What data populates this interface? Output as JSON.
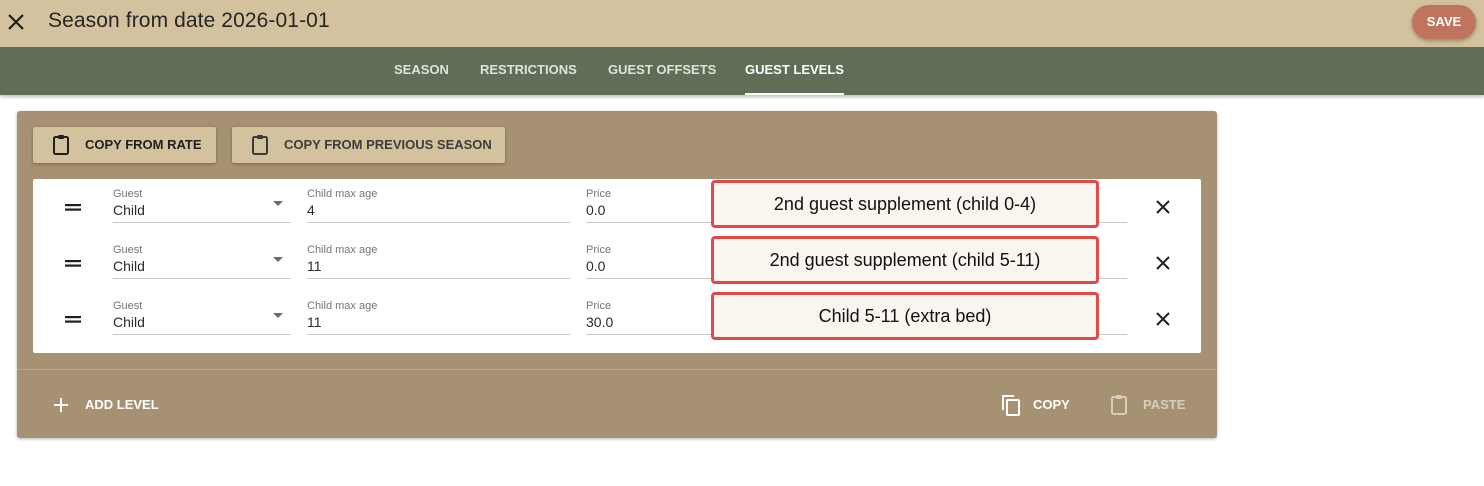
{
  "header": {
    "title": "Season from date 2026-01-01",
    "save_label": "SAVE",
    "close_icon": "close-icon",
    "bg_color": "#d3c29d",
    "save_color": "#c0745d"
  },
  "tabs": [
    {
      "label": "SEASON",
      "active": false
    },
    {
      "label": "RESTRICTIONS",
      "active": false
    },
    {
      "label": "GUEST OFFSETS",
      "active": false
    },
    {
      "label": "GUEST LEVELS",
      "active": true
    }
  ],
  "tabbar_color": "#616e57",
  "card": {
    "bg_color": "#a69272",
    "copy_from_rate_label": "COPY FROM RATE",
    "copy_from_previous_label": "COPY FROM PREVIOUS SEASON",
    "add_level_label": "ADD LEVEL",
    "copy_label": "COPY",
    "paste_label": "PASTE"
  },
  "levels": [
    {
      "guest_label": "Guest",
      "guest_value": "Child",
      "age_label": "Child max age",
      "age_value": "4",
      "price_label": "Price",
      "price_value": "0.0",
      "description": "2nd guest supplement (child 0-4)"
    },
    {
      "guest_label": "Guest",
      "guest_value": "Child",
      "age_label": "Child max age",
      "age_value": "11",
      "price_label": "Price",
      "price_value": "0.0",
      "description": "2nd guest supplement (child 5-11)"
    },
    {
      "guest_label": "Guest",
      "guest_value": "Child",
      "age_label": "Child max age",
      "age_value": "11",
      "price_label": "Price",
      "price_value": "30.0",
      "description": "Child 5-11 (extra bed)"
    }
  ]
}
